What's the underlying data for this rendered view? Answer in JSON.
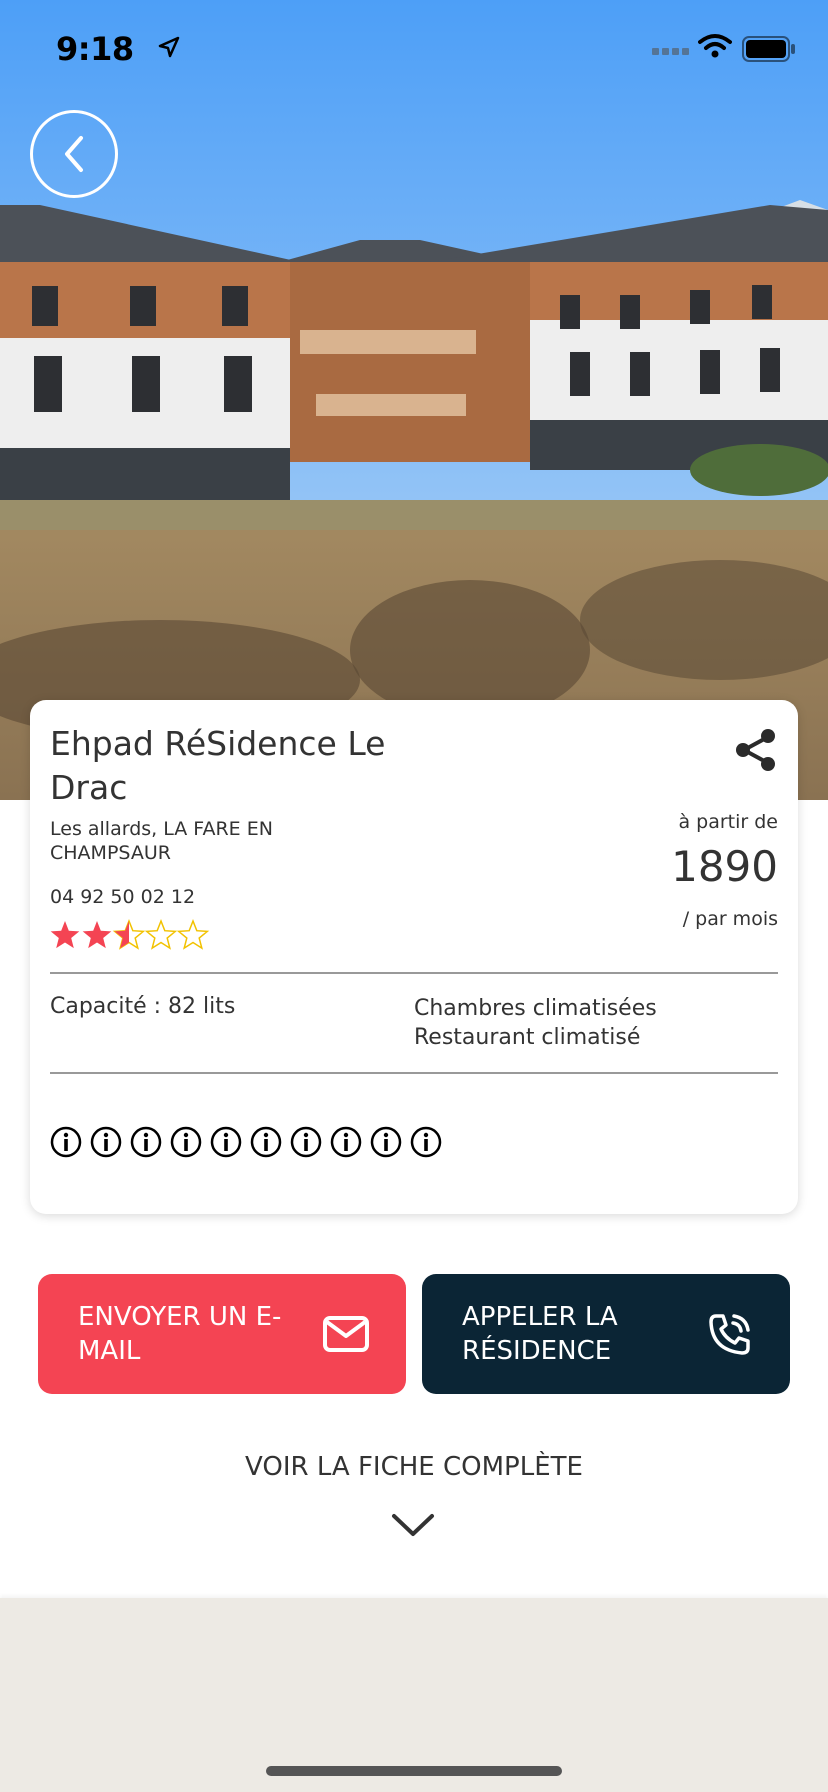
{
  "status_bar": {
    "time": "9:18"
  },
  "header": {
    "back_icon": "chevron-left-icon"
  },
  "residence": {
    "name": "Ehpad RéSidence Le Drac",
    "address": "Les allards, LA FARE EN CHAMPSAUR",
    "phone": "04 92 50 02 12",
    "rating": 2.5,
    "rating_max": 5,
    "price_from_label": "à partir de",
    "price": "1890",
    "price_unit_label": "/ par mois",
    "capacity": "Capacité : 82 lits",
    "features": [
      "Chambres climatisées",
      "Restaurant climatisé"
    ],
    "info_icon_count": 10
  },
  "actions": {
    "email_label": "ENVOYER UN E-MAIL",
    "call_label": "APPELER LA RÉSIDENCE"
  },
  "see_full_label": "VOIR LA FICHE COMPLÈTE",
  "colors": {
    "email_button": "#f44453",
    "call_button": "#0b2535",
    "star_filled": "#f44453",
    "star_outline": "#f2c200",
    "bottom_panel": "#edeae4"
  }
}
